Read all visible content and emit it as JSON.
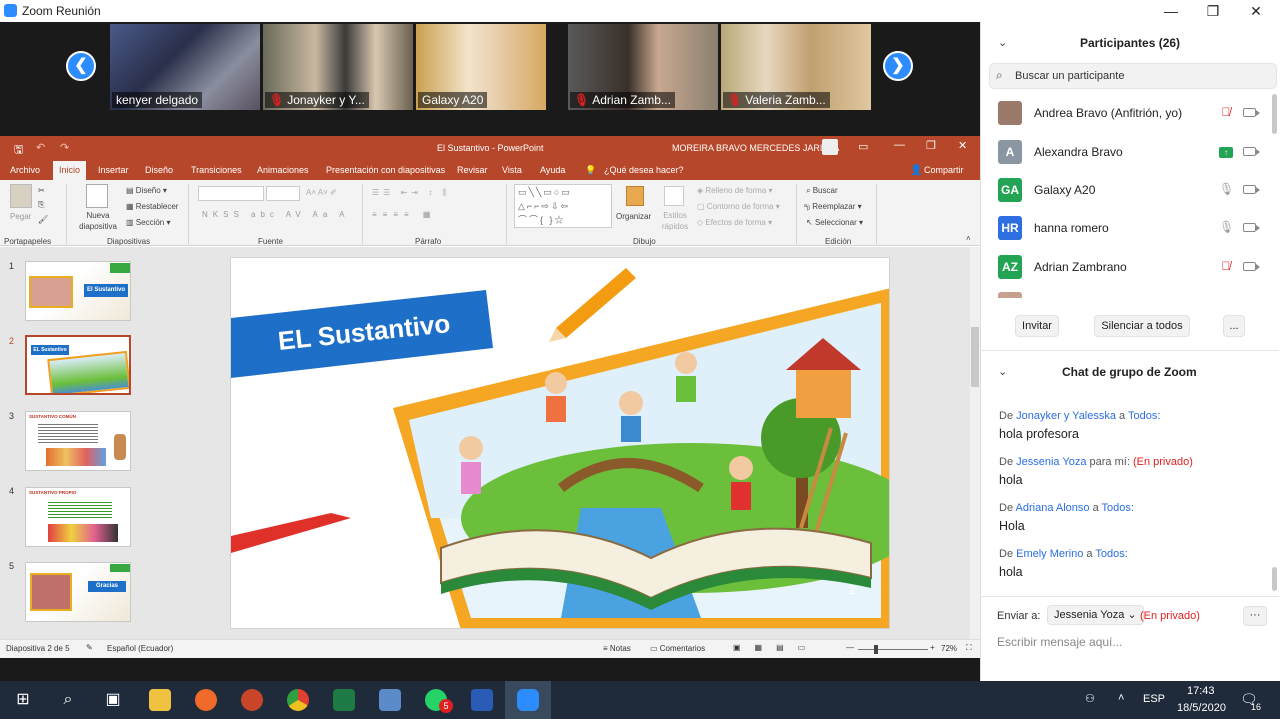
{
  "zoom": {
    "window_title": "Zoom Reunión",
    "video_tiles": [
      {
        "name": "kenyer delgado",
        "muted": false
      },
      {
        "name": "Jonayker y Y...",
        "muted": true
      },
      {
        "name": "Galaxy A20",
        "muted": false
      },
      {
        "name": "Adrian Zamb...",
        "muted": true
      },
      {
        "name": "Valeria Zamb...",
        "muted": true
      }
    ],
    "prev_glyph": "❮",
    "next_glyph": "❯"
  },
  "ppt": {
    "doc_title": "El Sustantivo  -  PowerPoint",
    "user_name": "MOREIRA BRAVO MERCEDES JARITZA",
    "tabs": [
      "Archivo",
      "Inicio",
      "Insertar",
      "Diseño",
      "Transiciones",
      "Animaciones",
      "Presentación con diapositivas",
      "Revisar",
      "Vista",
      "Ayuda"
    ],
    "tell_me": "¿Qué desea hacer?",
    "share": "Compartir",
    "ribbon": {
      "paste": "Pegar",
      "new_slide": "Nueva diapositiva",
      "layout": "Diseño",
      "reset": "Restablecer",
      "section": "Sección",
      "organize": "Organizar",
      "quick_styles": "Estilos rápidos",
      "fill": "Relleno de forma",
      "outline": "Contorno de forma",
      "effects": "Efectos de forma",
      "find": "Buscar",
      "replace": "Reemplazar",
      "select": "Seleccionar",
      "groups": [
        "Portapapeles",
        "Diapositivas",
        "Fuente",
        "Párrafo",
        "Dibujo",
        "Edición"
      ]
    },
    "slides": [
      {
        "num": "1",
        "label": "El Sustantivo"
      },
      {
        "num": "2",
        "label": "EL Sustantivo"
      },
      {
        "num": "3",
        "label": "SUSTANTIVO COMÚN"
      },
      {
        "num": "4",
        "label": "SUSTANTIVO PROPIO"
      },
      {
        "num": "5",
        "label": "Gracias"
      }
    ],
    "current_slide": {
      "title": "EL Sustantivo",
      "page_number": "2"
    },
    "status": {
      "slide_of": "Diapositiva 2 de 5",
      "language": "Español (Ecuador)",
      "notes": "Notas",
      "comments": "Comentarios",
      "zoom": "72%"
    }
  },
  "panel": {
    "participants_title": "Participantes (26)",
    "search_placeholder": "Buscar un participante",
    "participants": [
      {
        "initials": "",
        "name": "Andrea Bravo (Anfitrión, yo)",
        "color": "#9a7b6a",
        "mic": "muted"
      },
      {
        "initials": "A",
        "name": "Alexandra Bravo",
        "color": "#8b96a3",
        "mic": "share"
      },
      {
        "initials": "GA",
        "name": "Galaxy A20",
        "color": "#23a455",
        "mic": "on"
      },
      {
        "initials": "HR",
        "name": "hanna romero",
        "color": "#2d6ee0",
        "mic": "on"
      },
      {
        "initials": "AZ",
        "name": "Adrian Zambrano",
        "color": "#23a455",
        "mic": "muted"
      }
    ],
    "invite": "Invitar",
    "mute_all": "Silenciar a todos",
    "more": "...",
    "chat_title": "Chat de grupo de Zoom",
    "chat": [
      {
        "from_prefix": "De ",
        "from": "Jonayker y Yalesska",
        "mid": " a ",
        "to": "Todos:",
        "private": "",
        "msg": "hola profesora"
      },
      {
        "from_prefix": "De ",
        "from": "Jessenia Yoza",
        "mid": " para mí: ",
        "to": "",
        "private": "(En privado)",
        "msg": "hola"
      },
      {
        "from_prefix": "De ",
        "from": "Adriana Alonso",
        "mid": " a ",
        "to": "Todos:",
        "private": "",
        "msg": "Hola"
      },
      {
        "from_prefix": "De ",
        "from": "Emely Merino",
        "mid": " a ",
        "to": "Todos:",
        "private": "",
        "msg": "hola"
      }
    ],
    "send_to_label": "Enviar a:",
    "send_to_value": "Jessenia Yoza",
    "send_private": "(En privado)",
    "message_placeholder": "Escribir mensaje aquí..."
  },
  "taskbar": {
    "lang": "ESP",
    "time": "17:43",
    "date": "18/5/2020",
    "notif_count": "16",
    "whatsapp_badge": "5"
  }
}
